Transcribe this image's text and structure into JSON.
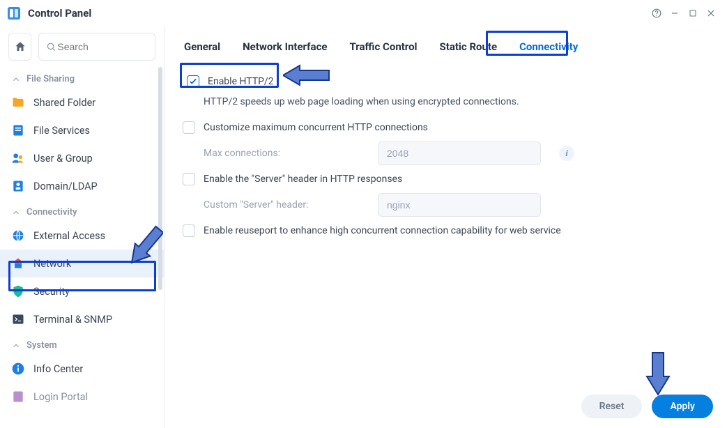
{
  "window": {
    "title": "Control Panel"
  },
  "search": {
    "placeholder": "Search"
  },
  "sidebar": {
    "groups": {
      "file_sharing": {
        "label": "File Sharing"
      },
      "connectivity": {
        "label": "Connectivity"
      },
      "system": {
        "label": "System"
      }
    },
    "items": {
      "shared_folder": "Shared Folder",
      "file_services": "File Services",
      "user_group": "User & Group",
      "domain_ldap": "Domain/LDAP",
      "external_access": "External Access",
      "network": "Network",
      "security": "Security",
      "terminal_snmp": "Terminal & SNMP",
      "info_center": "Info Center",
      "login_portal": "Login Portal"
    }
  },
  "tabs": {
    "general": "General",
    "network_interface": "Network Interface",
    "traffic_control": "Traffic Control",
    "static_route": "Static Route",
    "connectivity": "Connectivity"
  },
  "connectivity": {
    "enable_http2": {
      "label": "Enable HTTP/2",
      "checked": true
    },
    "http2_desc": "HTTP/2 speeds up web page loading when using encrypted connections.",
    "customize_max_conn": {
      "label": "Customize maximum concurrent HTTP connections",
      "checked": false
    },
    "max_conn_label": "Max connections:",
    "max_conn_value": "2048",
    "enable_server_header": {
      "label": "Enable the \"Server\" header in HTTP responses",
      "checked": false
    },
    "custom_server_header_label": "Custom \"Server\" header:",
    "custom_server_header_value": "nginx",
    "enable_reuseport": {
      "label": "Enable reuseport to enhance high concurrent connection capability for web service",
      "checked": false
    }
  },
  "footer": {
    "reset": "Reset",
    "apply": "Apply"
  }
}
